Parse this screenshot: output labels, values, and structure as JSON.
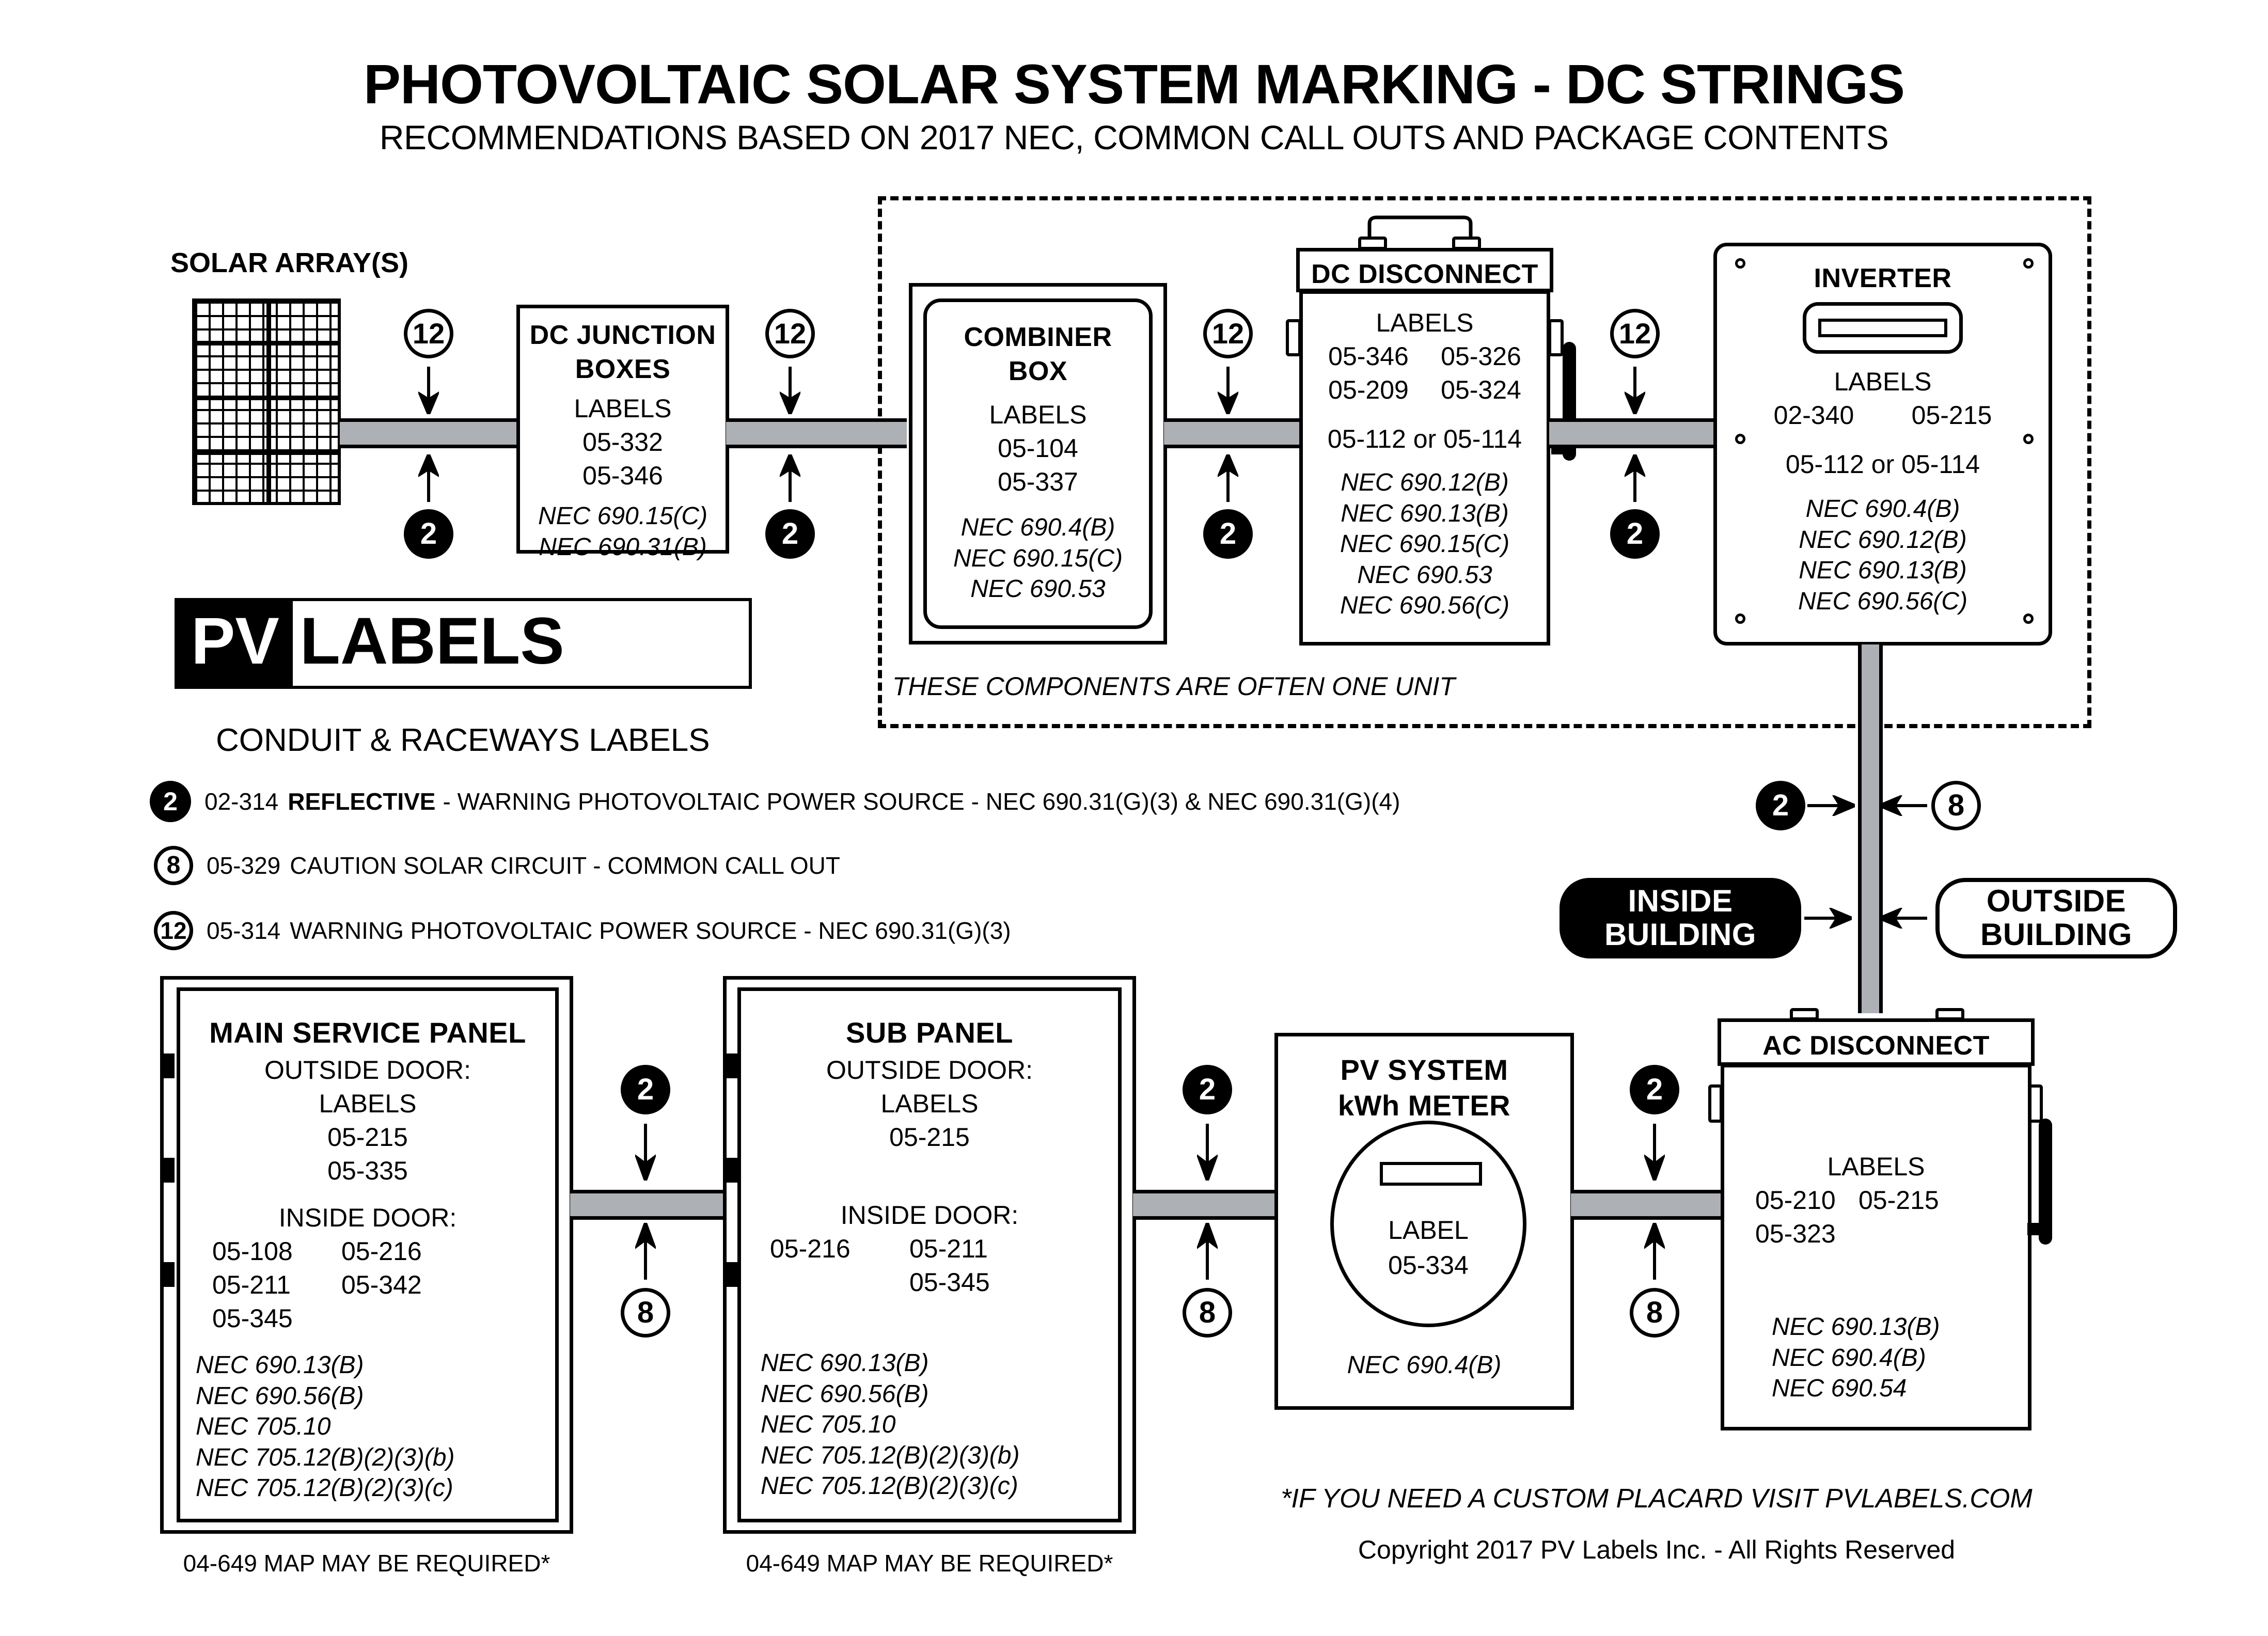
{
  "header": {
    "title": "PHOTOVOLTAIC SOLAR SYSTEM MARKING - DC STRINGS",
    "subtitle": "RECOMMENDATIONS BASED ON 2017 NEC, COMMON CALL OUTS AND PACKAGE CONTENTS"
  },
  "array": {
    "caption": "SOLAR ARRAY(S)"
  },
  "logo": {
    "part1": "PV",
    "part2": "LABELS"
  },
  "dashed_note": "THESE COMPONENTS ARE OFTEN ONE UNIT",
  "legend": {
    "heading": "CONDUIT & RACEWAYS LABELS",
    "items": [
      {
        "badge": "2",
        "style": "dark",
        "code": "02-314",
        "emphasis": "REFLECTIVE",
        "text": "- WARNING PHOTOVOLTAIC POWER SOURCE  - NEC 690.31(G)(3) & NEC 690.31(G)(4)"
      },
      {
        "badge": "8",
        "style": "light",
        "code": "05-329",
        "emphasis": "",
        "text": "CAUTION SOLAR CIRCUIT - COMMON CALL OUT"
      },
      {
        "badge": "12",
        "style": "light",
        "code": "05-314",
        "emphasis": "",
        "text": "WARNING PHOTOVOLTAIC POWER SOURCE  - NEC 690.31(G)(3)"
      }
    ]
  },
  "boxes": {
    "dc_junction": {
      "title_line1": "DC JUNCTION",
      "title_line2": "BOXES",
      "labels_heading": "LABELS",
      "labels": [
        "05-332",
        "05-346"
      ],
      "nec": [
        "NEC 690.15(C)",
        "NEC 690.31(B)"
      ]
    },
    "combiner": {
      "title_line1": "COMBINER",
      "title_line2": "BOX",
      "labels_heading": "LABELS",
      "labels": [
        "05-104",
        "05-337"
      ],
      "nec": [
        "NEC 690.4(B)",
        "NEC 690.15(C)",
        "NEC 690.53"
      ]
    },
    "dc_disconnect": {
      "title": "DC DISCONNECT",
      "labels_heading": "LABELS",
      "labels_grid": [
        [
          "05-346",
          "05-326"
        ],
        [
          "05-209",
          "05-324"
        ]
      ],
      "labels_alt": "05-112 or 05-114",
      "nec": [
        "NEC 690.12(B)",
        "NEC 690.13(B)",
        "NEC 690.15(C)",
        "NEC 690.53",
        "NEC 690.56(C)"
      ]
    },
    "inverter": {
      "title": "INVERTER",
      "labels_heading": "LABELS",
      "labels_grid": [
        [
          "02-340",
          "05-215"
        ]
      ],
      "labels_alt": "05-112 or 05-114",
      "nec": [
        "NEC 690.4(B)",
        "NEC 690.12(B)",
        "NEC 690.13(B)",
        "NEC 690.56(C)"
      ]
    },
    "main_service_panel": {
      "title": "MAIN SERVICE PANEL",
      "outside_heading": "OUTSIDE DOOR:",
      "outside_labels_heading": "LABELS",
      "outside_labels": [
        "05-215",
        "05-335"
      ],
      "inside_heading": "INSIDE DOOR:",
      "inside_labels_grid": [
        [
          "05-108",
          "05-216"
        ],
        [
          "05-211",
          "05-342"
        ],
        [
          "05-345",
          ""
        ]
      ],
      "nec": [
        "NEC 690.13(B)",
        "NEC 690.56(B)",
        "NEC 705.10",
        "NEC 705.12(B)(2)(3)(b)",
        "NEC 705.12(B)(2)(3)(c)"
      ],
      "footnote": "04-649 MAP MAY BE REQUIRED*"
    },
    "sub_panel": {
      "title": "SUB PANEL",
      "outside_heading": "OUTSIDE DOOR:",
      "outside_labels_heading": "LABELS",
      "outside_labels": [
        "05-215"
      ],
      "inside_heading": "INSIDE DOOR:",
      "inside_labels_grid": [
        [
          "05-216",
          "05-211"
        ],
        [
          "",
          "05-345"
        ]
      ],
      "nec": [
        "NEC 690.13(B)",
        "NEC 690.56(B)",
        "NEC 705.10",
        "NEC 705.12(B)(2)(3)(b)",
        "NEC 705.12(B)(2)(3)(c)"
      ],
      "footnote": "04-649 MAP MAY BE REQUIRED*"
    },
    "kwh_meter": {
      "title_line1": "PV SYSTEM",
      "title_line2": "kWh METER",
      "label_heading": "LABEL",
      "label": "05-334",
      "nec": [
        "NEC 690.4(B)"
      ]
    },
    "ac_disconnect": {
      "title": "AC DISCONNECT",
      "labels_heading": "LABELS",
      "labels_grid": [
        [
          "05-210",
          "05-215"
        ],
        [
          "05-323",
          ""
        ]
      ],
      "nec": [
        "NEC 690.13(B)",
        "NEC 690.4(B)",
        "NEC 690.54"
      ]
    }
  },
  "building": {
    "inside": "INSIDE\nBUILDING",
    "inside_line1": "INSIDE",
    "inside_line2": "BUILDING",
    "outside_line1": "OUTSIDE",
    "outside_line2": "BUILDING"
  },
  "badges": {
    "b12": "12",
    "b8": "8",
    "b2": "2"
  },
  "footer": {
    "custom_note": "*IF YOU NEED A CUSTOM PLACARD VISIT PVLABELS.COM",
    "copyright": "Copyright 2017 PV Labels Inc. - All Rights Reserved"
  },
  "colors": {
    "conduit": "#adb0b5",
    "ink": "#000000",
    "paper": "#ffffff"
  }
}
